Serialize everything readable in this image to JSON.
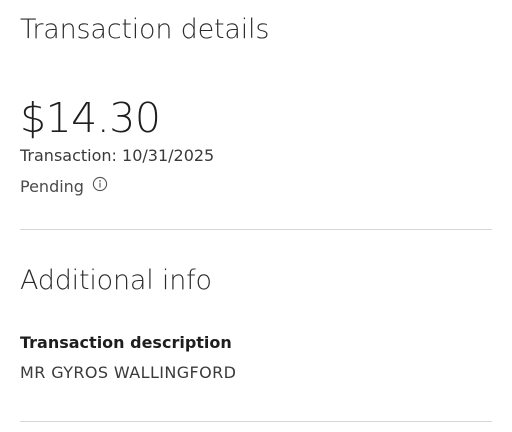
{
  "header": {
    "title": "Transaction details"
  },
  "transaction": {
    "amount": "$14.30",
    "date_line": "Transaction: 10/31/2025",
    "status": "Pending",
    "status_icon": "info-icon"
  },
  "additional_info": {
    "section_title": "Additional info",
    "description_label": "Transaction description",
    "description_value": "MR GYROS WALLINGFORD"
  }
}
